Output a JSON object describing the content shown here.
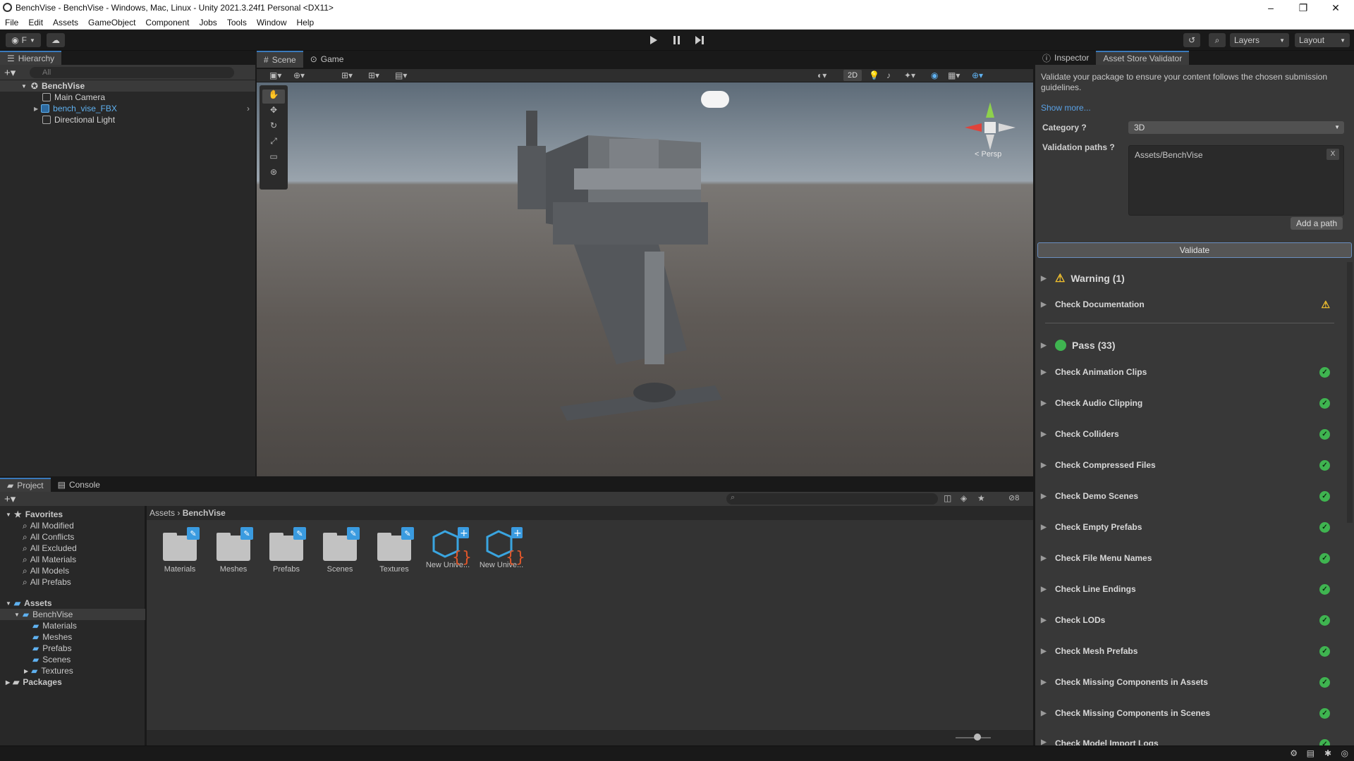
{
  "window": {
    "title": "BenchVise - BenchVise - Windows, Mac, Linux - Unity 2021.3.24f1 Personal <DX11>"
  },
  "menu": [
    "File",
    "Edit",
    "Assets",
    "GameObject",
    "Component",
    "Jobs",
    "Tools",
    "Window",
    "Help"
  ],
  "toolbar": {
    "account": "F",
    "layers": "Layers",
    "layout": "Layout"
  },
  "hierarchy": {
    "tab": "Hierarchy",
    "search_placeholder": "All",
    "scene": "BenchVise",
    "items": [
      "Main Camera",
      "bench_vise_FBX",
      "Directional Light"
    ]
  },
  "scene_tabs": [
    "Scene",
    "Game"
  ],
  "scene_view": {
    "mode_2d": "2D",
    "persp": "< Persp"
  },
  "inspector": {
    "tabs": [
      "Inspector",
      "Asset Store Validator"
    ],
    "description": "Validate your package to ensure your content follows the chosen submission guidelines.",
    "show_more": "Show more...",
    "category_label": "Category",
    "category_value": "3D",
    "validation_paths_label": "Validation paths",
    "validation_path": "Assets/BenchVise",
    "remove_path": "X",
    "add_path": "Add a path",
    "validate": "Validate",
    "warning_header": "Warning (1)",
    "warning_items": [
      "Check Documentation"
    ],
    "pass_header": "Pass (33)",
    "pass_items": [
      "Check Animation Clips",
      "Check Audio Clipping",
      "Check Colliders",
      "Check Compressed Files",
      "Check Demo Scenes",
      "Check Empty Prefabs",
      "Check File Menu Names",
      "Check Line Endings",
      "Check LODs",
      "Check Mesh Prefabs",
      "Check Missing Components in Assets",
      "Check Missing Components in Scenes",
      "Check Model Import Logs"
    ]
  },
  "project": {
    "tabs": [
      "Project",
      "Console"
    ],
    "hidden_count": "8",
    "favorites_label": "Favorites",
    "favorites": [
      "All Modified",
      "All Conflicts",
      "All Excluded",
      "All Materials",
      "All Models",
      "All Prefabs"
    ],
    "assets_label": "Assets",
    "asset_tree": [
      "BenchVise",
      "Materials",
      "Meshes",
      "Prefabs",
      "Scenes",
      "Textures"
    ],
    "packages_label": "Packages",
    "breadcrumb": [
      "Assets",
      "BenchVise"
    ],
    "items": [
      "Materials",
      "Meshes",
      "Prefabs",
      "Scenes",
      "Textures",
      "New Unive...",
      "New Unive..."
    ]
  },
  "colors": {
    "accent": "#3a79bb",
    "pass": "#3fb450",
    "warning": "#f2c12e"
  }
}
